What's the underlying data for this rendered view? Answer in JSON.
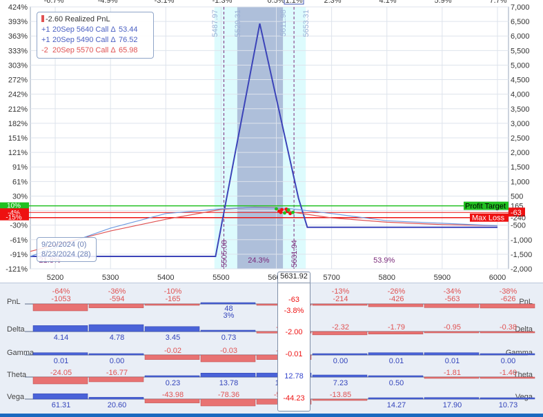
{
  "chart_data": {
    "type": "line",
    "x_ticks": [
      5200,
      5300,
      5400,
      5500,
      5600,
      5700,
      5800,
      5900,
      6000
    ],
    "x_range": [
      5155,
      6020
    ],
    "left_axis": {
      "ticks": [
        "424%",
        "393%",
        "363%",
        "333%",
        "303%",
        "272%",
        "242%",
        "212%",
        "182%",
        "151%",
        "121%",
        "91%",
        "61%",
        "30%",
        "0%",
        "-30%",
        "-61%",
        "-91%",
        "-121%"
      ],
      "range": [
        -121,
        424
      ]
    },
    "right_axis": {
      "ticks": [
        "7,000",
        "6,500",
        "6,000",
        "5,500",
        "5,000",
        "4,500",
        "4,000",
        "3,500",
        "3,000",
        "2,500",
        "2,000",
        "1,500",
        "1,000",
        "500",
        "0",
        "-500",
        "-1,000",
        "-1,500",
        "-2,000"
      ],
      "range": [
        -2000,
        7000
      ]
    },
    "top_ticks": [
      "-6.7%",
      "-4.9%",
      "-3.1%",
      "-1.3%",
      "0.5%",
      "1.1%",
      "2.3%",
      "4.1%",
      "5.9%",
      "7.7%"
    ],
    "series": [
      {
        "name": "expiration",
        "color": "#3b43b8",
        "x": [
          5155,
          5490,
          5570,
          5640,
          5656,
          6000
        ],
        "y": [
          -1573,
          -1573,
          6427,
          427,
          -573,
          -573
        ]
      },
      {
        "name": "today",
        "color": "#e05252",
        "x": [
          5155,
          5300,
          5400,
          5500,
          5560,
          5600,
          5632,
          5700,
          5800,
          5900,
          6000
        ],
        "y": [
          -1400,
          -700,
          -300,
          40,
          120,
          100,
          -63,
          -250,
          -400,
          -480,
          -520
        ]
      },
      {
        "name": "intermediate",
        "color": "#6f9be0",
        "x": [
          5155,
          5300,
          5400,
          5500,
          5560,
          5620,
          5700,
          5800,
          6000
        ],
        "y": [
          -1573,
          -600,
          -100,
          60,
          110,
          80,
          -100,
          -350,
          -520
        ]
      }
    ],
    "vertical_labels": [
      {
        "x": 5487.97,
        "text": "5487.97"
      },
      {
        "x": 5529.31,
        "text": "5529.31"
      },
      {
        "x": 5611.98,
        "text": "5611.98"
      },
      {
        "x": 5653.31,
        "text": "5653.31"
      },
      {
        "x": 5505.08,
        "text": "5505.08"
      },
      {
        "x": 5631.94,
        "text": "5631.94"
      }
    ],
    "zones": [
      {
        "x": 5190,
        "text": "21.8%"
      },
      {
        "x": 5568,
        "text": "24.3%"
      },
      {
        "x": 5795,
        "text": "53.9%"
      }
    ],
    "left_tags": [
      "10%",
      "-4%",
      "-15%"
    ],
    "lines": {
      "profit_target": {
        "label": "Profit Target",
        "value": "165",
        "y": 165
      },
      "max_loss": {
        "label": "Max Loss",
        "value": "-240",
        "y": -240
      },
      "current": {
        "value": "-63",
        "y": -63
      }
    }
  },
  "legend": {
    "realized": "-2.60 Realized PnL",
    "rows": [
      {
        "qty": "+1",
        "desc": "20Sep 5640 Call Δ",
        "delta": "53.44",
        "color": "#4a5fc2"
      },
      {
        "qty": "+1",
        "desc": "20Sep 5490 Call Δ",
        "delta": "76.52",
        "color": "#4a5fc2"
      },
      {
        "qty": "-2",
        "desc": "20Sep 5570 Call Δ",
        "delta": "65.98",
        "color": "#e05252"
      }
    ]
  },
  "dates": {
    "expiry": "9/20/2024 (0)",
    "current": "8/23/2024 (28)"
  },
  "greeks": {
    "center_price": "5631.92",
    "rows": [
      {
        "name": "PnL",
        "values": [
          "-64%\n-1053",
          "-36%\n-594",
          "-10%\n-165",
          "48\n3%",
          "0%\n-4",
          "-13%\n-214",
          "-26%\n-426",
          "-34%\n-563",
          "-38%\n-626"
        ],
        "nums": [
          -1053,
          -594,
          -165,
          48,
          -4,
          -214,
          -426,
          -563,
          -626
        ],
        "center": "-63",
        "center2": "-3.8%"
      },
      {
        "name": "Delta",
        "values": [
          "4.14",
          "4.78",
          "3.45",
          "0.73",
          "-1.09",
          "-2.32",
          "-1.79",
          "-0.95",
          "-0.38"
        ],
        "nums": [
          4.14,
          4.78,
          3.45,
          0.73,
          -1.09,
          -2.32,
          -1.79,
          -0.95,
          -0.38
        ],
        "center": "-2.00"
      },
      {
        "name": "Gamma",
        "values": [
          "0.01",
          "0.00",
          "-0.02",
          "-0.03",
          "-0.02",
          "0.00",
          "0.01",
          "0.01",
          "0.00"
        ],
        "nums": [
          0.01,
          0.0,
          -0.02,
          -0.03,
          -0.02,
          0.0,
          0.01,
          0.01,
          0.0
        ],
        "center": "-0.01"
      },
      {
        "name": "Theta",
        "values": [
          "-24.05",
          "-16.77",
          "0.23",
          "13.78",
          "14.10",
          "7.23",
          "0.50",
          "-1.81",
          "-1.40"
        ],
        "nums": [
          -24.05,
          -16.77,
          0.23,
          13.78,
          14.1,
          7.23,
          0.5,
          -1.81,
          -1.4
        ],
        "center": "12.78"
      },
      {
        "name": "Vega",
        "values": [
          "61.31",
          "20.60",
          "-43.98",
          "-78.36",
          "-58.50",
          "-13.85",
          "14.27",
          "17.90",
          "10.73"
        ],
        "nums": [
          61.31,
          20.6,
          -43.98,
          -78.36,
          -58.5,
          -13.85,
          14.27,
          17.9,
          10.73
        ],
        "center": "-44.23"
      }
    ]
  },
  "colors": {
    "positive": "#4a63d8",
    "negative": "#e87272",
    "profit": "#21c021",
    "loss": "#ee1111",
    "band": "#aebfda",
    "band_light": "#ddfbfd"
  }
}
